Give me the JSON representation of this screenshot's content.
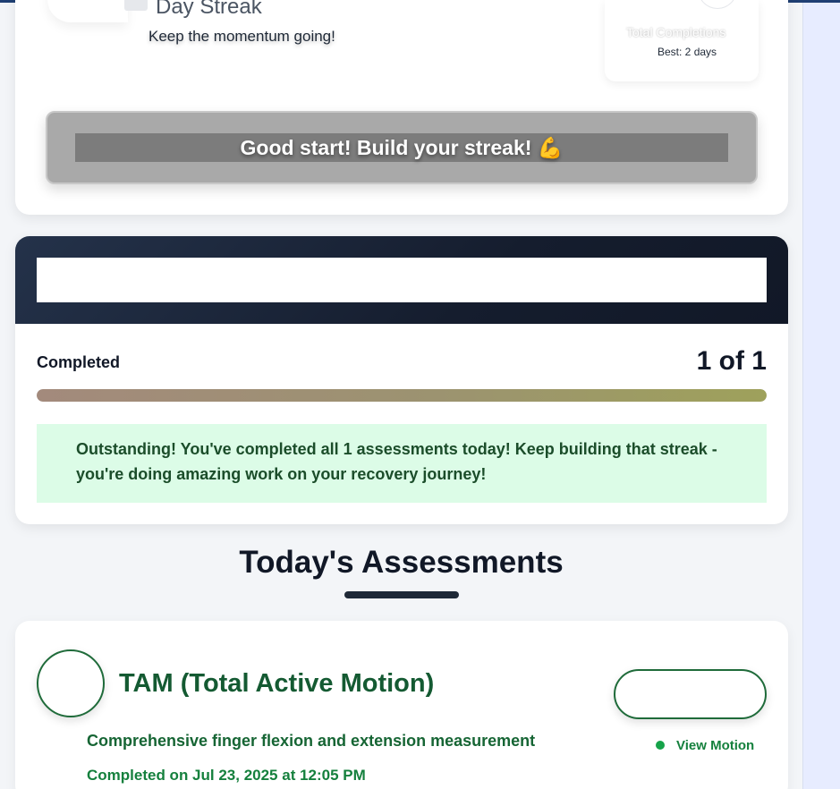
{
  "streak": {
    "title": "Day Streak",
    "subtitle": "Keep the momentum going!",
    "stat_label": "Total Completions",
    "best": "Best: 2 days",
    "motivation": "Good start! Build your streak! 💪"
  },
  "progress": {
    "completed_label": "Completed",
    "completed_count": "1 of 1",
    "completed_fraction": 1.0,
    "message": "Outstanding! You've completed all 1 assessments today! Keep building that streak - you're doing amazing work on your recovery journey!"
  },
  "assessments": {
    "heading": "Today's Assessments",
    "items": [
      {
        "title": "TAM (Total Active Motion)",
        "description": "Comprehensive finger flexion and extension measurement",
        "completed_on": "Completed on Jul 23, 2025 at 12:05 PM",
        "view_label": "View Motion"
      }
    ]
  },
  "colors": {
    "accent_green": "#15803d",
    "header_dark": "#111827",
    "success_bg": "#dcfce7",
    "bolt_blue": "#2563eb"
  },
  "icons": {
    "streak": "lightning-bolt-icon",
    "status": "status-dot-icon"
  }
}
